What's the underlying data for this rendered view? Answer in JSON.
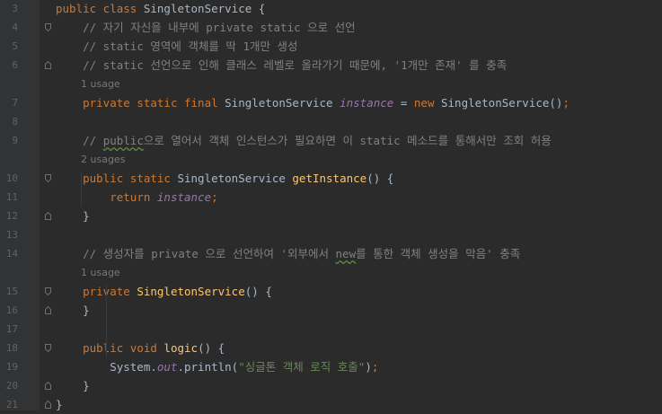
{
  "editor": {
    "lines": [
      {
        "num": "3",
        "code": [
          [
            "kw",
            "public class "
          ],
          [
            "pl",
            "SingletonService {"
          ]
        ]
      },
      {
        "num": "4",
        "code": [
          [
            "pl",
            "    "
          ],
          [
            "cm",
            "// 자기 자신을 내부에 private static 으로 선언"
          ]
        ]
      },
      {
        "num": "5",
        "code": [
          [
            "pl",
            "    "
          ],
          [
            "cm",
            "// static 영역에 객체를 딱 1개만 생성"
          ]
        ]
      },
      {
        "num": "6",
        "code": [
          [
            "pl",
            "    "
          ],
          [
            "cm",
            "// static 선언으로 인해 클래스 레벨로 올라가기 때문에, '1개만 존재' 를 충족"
          ]
        ]
      },
      {
        "hint": "1 usage"
      },
      {
        "num": "7",
        "code": [
          [
            "pl",
            "    "
          ],
          [
            "kw",
            "private static final "
          ],
          [
            "pl",
            "SingletonService "
          ],
          [
            "inst",
            "instance"
          ],
          [
            "pl",
            " = "
          ],
          [
            "kw",
            "new "
          ],
          [
            "pl",
            "SingletonService()"
          ],
          [
            "kw",
            ";"
          ]
        ]
      },
      {
        "num": "8",
        "code": []
      },
      {
        "num": "9",
        "code": [
          [
            "pl",
            "    "
          ],
          [
            "cm",
            "// "
          ],
          [
            "cmtypo",
            "public"
          ],
          [
            "cm",
            "으로 열어서 객체 인스턴스가 필요하면 이 static 메소드를 통해서만 조회 허용"
          ]
        ]
      },
      {
        "hint": "2 usages"
      },
      {
        "num": "10",
        "code": [
          [
            "pl",
            "    "
          ],
          [
            "kw",
            "public static "
          ],
          [
            "pl",
            "SingletonService "
          ],
          [
            "fn",
            "getInstance"
          ],
          [
            "pl",
            "() {"
          ]
        ]
      },
      {
        "num": "11",
        "code": [
          [
            "pl",
            "        "
          ],
          [
            "kw",
            "return "
          ],
          [
            "inst",
            "instance"
          ],
          [
            "kw",
            ";"
          ]
        ]
      },
      {
        "num": "12",
        "code": [
          [
            "pl",
            "    }"
          ]
        ]
      },
      {
        "num": "13",
        "code": []
      },
      {
        "num": "14",
        "code": [
          [
            "pl",
            "    "
          ],
          [
            "cm",
            "// 생성자를 private 으로 선언하여 '외부에서 "
          ],
          [
            "cmtypo",
            "new"
          ],
          [
            "cm",
            "를 통한 객체 생성을 막음' 충족"
          ]
        ]
      },
      {
        "hint": "1 usage"
      },
      {
        "num": "15",
        "code": [
          [
            "pl",
            "    "
          ],
          [
            "kw",
            "private "
          ],
          [
            "fn",
            "SingletonService"
          ],
          [
            "pl",
            "() {"
          ]
        ]
      },
      {
        "num": "16",
        "code": [
          [
            "pl",
            "    }"
          ]
        ]
      },
      {
        "num": "17",
        "code": []
      },
      {
        "num": "18",
        "code": [
          [
            "pl",
            "    "
          ],
          [
            "kw",
            "public void "
          ],
          [
            "fn",
            "logic"
          ],
          [
            "pl",
            "() {"
          ]
        ]
      },
      {
        "num": "19",
        "code": [
          [
            "pl",
            "        System."
          ],
          [
            "inst",
            "out"
          ],
          [
            "pl",
            ".println("
          ],
          [
            "str",
            "\"싱글톤 객체 로직 호출\""
          ],
          [
            "pl",
            ")"
          ],
          [
            "kw",
            ";"
          ]
        ]
      },
      {
        "num": "20",
        "code": [
          [
            "pl",
            "    }"
          ]
        ]
      },
      {
        "num": "21",
        "code": [
          [
            "pl",
            "}"
          ]
        ]
      }
    ]
  },
  "colors": {
    "background": "#2b2b2b",
    "keyword": "#cc7832",
    "comment": "#808080",
    "method": "#ffc66d",
    "field": "#9876aa",
    "string": "#6a8759",
    "plain": "#a9b7c6"
  },
  "icons": {
    "fold_start": "fold-start-icon",
    "fold_end": "fold-end-icon"
  }
}
